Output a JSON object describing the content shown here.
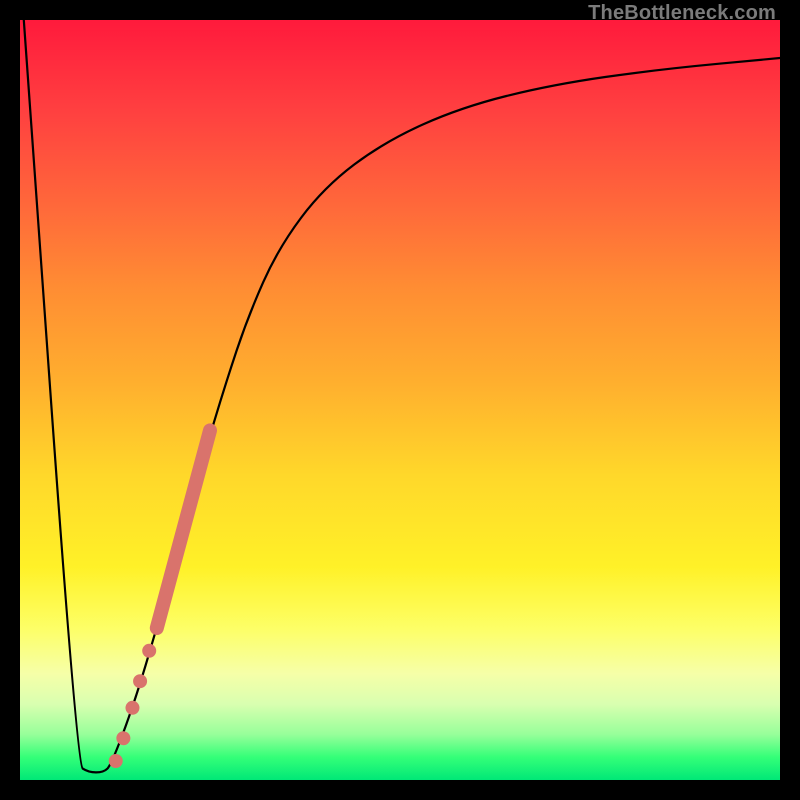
{
  "watermark": "TheBottleneck.com",
  "colors": {
    "highlight": "#d9736c",
    "curve": "#000000"
  },
  "chart_data": {
    "type": "line",
    "title": "",
    "xlabel": "",
    "ylabel": "",
    "xlim": [
      0,
      100
    ],
    "ylim": [
      0,
      100
    ],
    "grid": false,
    "curve": [
      {
        "x": 0.5,
        "y": 100
      },
      {
        "x": 7.5,
        "y": 2
      },
      {
        "x": 9.0,
        "y": 1
      },
      {
        "x": 11.0,
        "y": 1
      },
      {
        "x": 12.0,
        "y": 2
      },
      {
        "x": 15.0,
        "y": 10
      },
      {
        "x": 18.0,
        "y": 20
      },
      {
        "x": 21.0,
        "y": 31
      },
      {
        "x": 24.0,
        "y": 42
      },
      {
        "x": 27.0,
        "y": 52
      },
      {
        "x": 30.0,
        "y": 61
      },
      {
        "x": 34.0,
        "y": 70
      },
      {
        "x": 40.0,
        "y": 78
      },
      {
        "x": 48.0,
        "y": 84
      },
      {
        "x": 58.0,
        "y": 88.5
      },
      {
        "x": 70.0,
        "y": 91.5
      },
      {
        "x": 84.0,
        "y": 93.5
      },
      {
        "x": 100.0,
        "y": 95
      }
    ],
    "highlight_segment": [
      {
        "x": 18.0,
        "y": 20
      },
      {
        "x": 25.0,
        "y": 46
      }
    ],
    "dots": [
      {
        "x": 17.0,
        "y": 17
      },
      {
        "x": 15.8,
        "y": 13
      },
      {
        "x": 14.8,
        "y": 9.5
      },
      {
        "x": 13.6,
        "y": 5.5
      },
      {
        "x": 12.6,
        "y": 2.5
      }
    ]
  }
}
